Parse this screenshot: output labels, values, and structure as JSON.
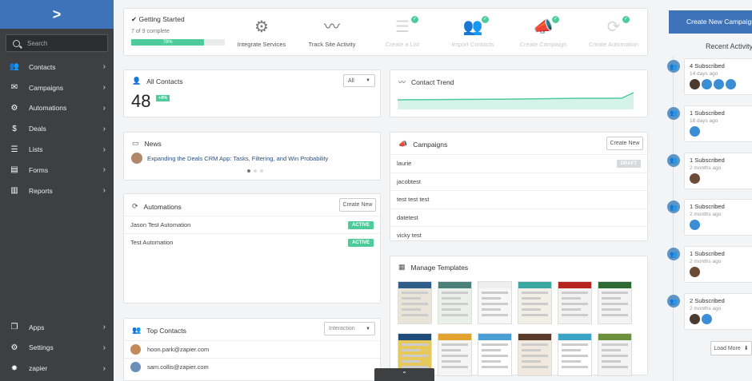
{
  "sidebar": {
    "search_placeholder": "Search",
    "items": [
      {
        "label": "Contacts",
        "icon": "contacts-icon",
        "glyph": "👥"
      },
      {
        "label": "Campaigns",
        "icon": "envelope-icon",
        "glyph": "✉"
      },
      {
        "label": "Automations",
        "icon": "automations-icon",
        "glyph": "⚙"
      },
      {
        "label": "Deals",
        "icon": "dollar-icon",
        "glyph": "$"
      },
      {
        "label": "Lists",
        "icon": "list-icon",
        "glyph": "☰"
      },
      {
        "label": "Forms",
        "icon": "form-icon",
        "glyph": "▤"
      },
      {
        "label": "Reports",
        "icon": "chart-icon",
        "glyph": "▥"
      }
    ],
    "bottom": [
      {
        "label": "Apps",
        "icon": "apps-icon",
        "glyph": "❐"
      },
      {
        "label": "Settings",
        "icon": "gear-icon",
        "glyph": "⚙"
      },
      {
        "label": "zapier",
        "icon": "zapier-icon",
        "glyph": "✸"
      }
    ]
  },
  "getting_started": {
    "title": "Getting Started",
    "progress_text": "7 of 9 complete",
    "progress_percent_label": "78%",
    "progress": 0.78,
    "steps": [
      {
        "label": "Integrate Services",
        "glyph": "⚙",
        "state": "active"
      },
      {
        "label": "Track Site Activity",
        "glyph": "〰",
        "state": "active"
      },
      {
        "label": "Create a List",
        "glyph": "☰",
        "state": "done"
      },
      {
        "label": "Import Contacts",
        "glyph": "👥",
        "state": "done"
      },
      {
        "label": "Create Campaign",
        "glyph": "📣",
        "state": "done"
      },
      {
        "label": "Create Automation",
        "glyph": "⟳",
        "state": "done"
      }
    ]
  },
  "all_contacts": {
    "title": "All Contacts",
    "count": "48",
    "delta": "+9%",
    "filter": "All"
  },
  "contact_trend": {
    "title": "Contact Trend"
  },
  "news": {
    "title": "News",
    "headline": "Expanding the Deals CRM App: Tasks, Filtering, and Win Probability"
  },
  "automations": {
    "title": "Automations",
    "create_label": "Create New",
    "rows": [
      {
        "name": "Jason Test Automation",
        "status": "ACTIVE"
      },
      {
        "name": "Test Automation",
        "status": "ACTIVE"
      }
    ]
  },
  "campaigns": {
    "title": "Campaigns",
    "create_label": "Create New",
    "rows": [
      {
        "name": "laurie",
        "status": "DRAFT"
      },
      {
        "name": "jacobtest",
        "status": ""
      },
      {
        "name": "test test test",
        "status": ""
      },
      {
        "name": "datetest",
        "status": ""
      },
      {
        "name": "vicky test",
        "status": ""
      }
    ]
  },
  "manage_templates": {
    "title": "Manage Templates"
  },
  "top_contacts": {
    "title": "Top Contacts",
    "filter": "Interaction",
    "rows": [
      {
        "email": "hoon.park@zapier.com"
      },
      {
        "email": "sam.collis@zapier.com"
      }
    ]
  },
  "right_panel": {
    "create_campaign_label": "Create New Campaign",
    "recent_activity_title": "Recent Activity",
    "load_more_label": "Load More",
    "items": [
      {
        "title": "4 Subscribed",
        "time": "14 days ago",
        "avatars": 4
      },
      {
        "title": "1 Subscribed",
        "time": "18 days ago",
        "avatars": 1
      },
      {
        "title": "1 Subscribed",
        "time": "2 months ago",
        "avatars": 1
      },
      {
        "title": "1 Subscribed",
        "time": "2 months ago",
        "avatars": 1
      },
      {
        "title": "1 Subscribed",
        "time": "2 months ago",
        "avatars": 1
      },
      {
        "title": "2 Subscribed",
        "time": "2 months ago",
        "avatars": 2
      }
    ]
  },
  "colors": {
    "brand_blue": "#3e73ba",
    "active_green": "#4ecb9a",
    "sidebar_bg": "#3e3f41"
  }
}
